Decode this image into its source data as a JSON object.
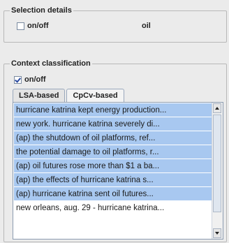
{
  "selection": {
    "title": "Selection details",
    "check_label": "on/off",
    "checked": false,
    "value": "oil"
  },
  "context": {
    "title": "Context classification",
    "check_label": "on/off",
    "checked": true,
    "tabs": [
      {
        "label": "LSA-based",
        "active": false
      },
      {
        "label": "CpCv-based",
        "active": true
      }
    ],
    "items": [
      {
        "text": "hurricane katrina kept energy production...",
        "selected": true
      },
      {
        "text": "new york.  hurricane katrina severely di...",
        "selected": true
      },
      {
        "text": "(ap)  the shutdown of oil platforms, ref...",
        "selected": true
      },
      {
        "text": "the potential damage to oil platforms, r...",
        "selected": true
      },
      {
        "text": "(ap)  oil futures rose more than $1 a ba...",
        "selected": true
      },
      {
        "text": "(ap)  the effects of hurricane katrina s...",
        "selected": true
      },
      {
        "text": "(ap)  hurricane katrina sent oil futures...",
        "selected": true
      },
      {
        "text": "new orleans, aug. 29 - hurricane katrina...",
        "selected": false
      }
    ]
  }
}
